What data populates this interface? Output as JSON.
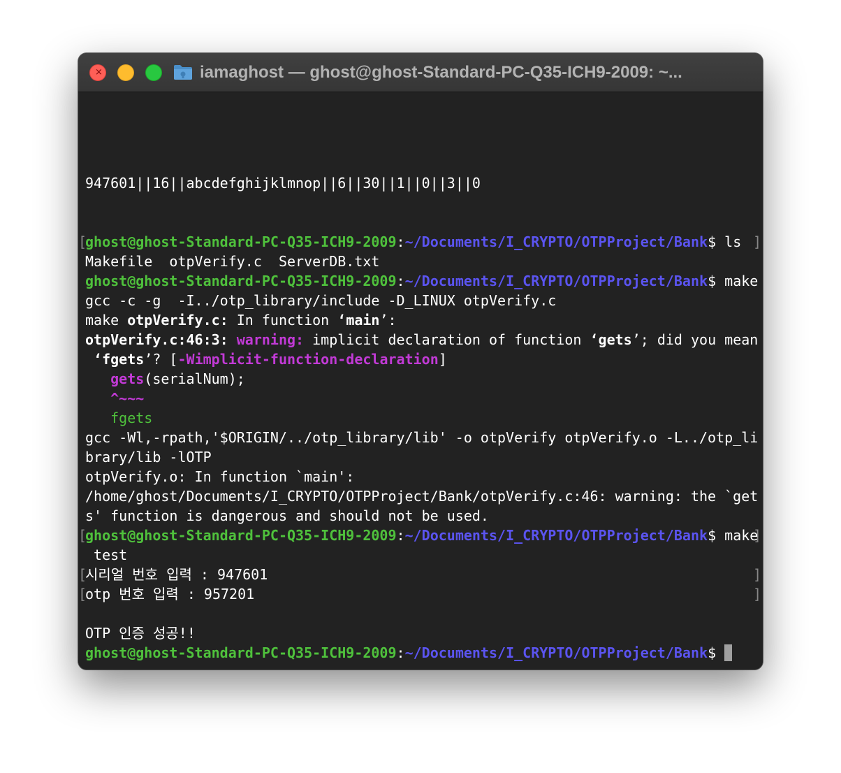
{
  "window": {
    "title": "iamaghost — ghost@ghost-Standard-PC-Q35-ICH9-2009: ~..."
  },
  "icons": {
    "close": "close-icon",
    "minimize": "minimize-icon",
    "maximize": "maximize-icon",
    "folder": "folder-icon"
  },
  "colors": {
    "prompt_user": "#4fc13c",
    "prompt_path": "#5b54f0",
    "warning": "#c23ad6",
    "background": "#222222"
  },
  "prompt": {
    "user_host": "ghost@ghost-Standard-PC-Q35-ICH9-2009",
    "colon": ":",
    "path": "~/Documents/I_CRYPTO/OTPProject/Bank",
    "dollar": "$"
  },
  "terminal": {
    "serverdb_line": "947601||16||abcdefghijklmnop||6||30||1||0||3||0",
    "cmd_ls": " ls",
    "ls_output": "Makefile  otpVerify.c  ServerDB.txt",
    "cmd_make": " make",
    "gcc_compile": "gcc -c -g  -I../otp_library/include -D_LINUX otpVerify.c",
    "make_in_fn_a": "make ",
    "make_in_fn_file": "otpVerify.c:",
    "make_in_fn_b": " In function ",
    "make_in_fn_q1": "‘",
    "make_in_fn_main": "main",
    "make_in_fn_q2": "’:",
    "warn_loc": "otpVerify.c:46:3:",
    "warn_sp": " ",
    "warn_word": "warning:",
    "warn_msg_a": " implicit declaration of function ",
    "warn_q1": "‘",
    "warn_gets": "gets",
    "warn_msg_b": "’; did you mean",
    "warn2_q1": " ‘",
    "warn2_fgets": "fgets",
    "warn2_mid": "’? [",
    "warn2_flag": "-Wimplicit-function-declaration",
    "warn2_end": "]",
    "code_indent": "   ",
    "code_gets": "gets",
    "code_rest": "(serialNum);",
    "caret": "   ^~~~",
    "fix_hint": "   fgets",
    "gcc_link_1": "gcc -Wl,-rpath,'$ORIGIN/../otp_library/lib' -o otpVerify otpVerify.o -L../otp_li",
    "gcc_link_2": "brary/lib -lOTP",
    "ld_fn": "otpVerify.o: In function `main':",
    "ld_warn_1": "/home/ghost/Documents/I_CRYPTO/OTPProject/Bank/otpVerify.c:46: warning: the `get",
    "ld_warn_2": "s' function is dangerous and should not be used.",
    "cmd_make_test_1": " make",
    "cmd_make_test_2": " test",
    "serial_input": "시리얼 번호 입력 : 947601",
    "otp_input": "otp 번호 입력 : 957201",
    "result": "OTP 인증 성공!!",
    "bracket_open": "[",
    "bracket_close": "]"
  }
}
